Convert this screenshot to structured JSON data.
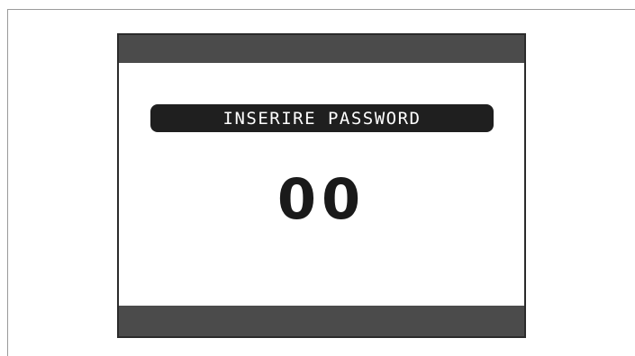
{
  "screen": {
    "prompt": "INSERIRE PASSWORD",
    "password_value": "00"
  },
  "colors": {
    "bar": "#4b4b4b",
    "banner": "#1f1f1f",
    "banner_text": "#ffffff",
    "digits": "#1a1a1a"
  }
}
